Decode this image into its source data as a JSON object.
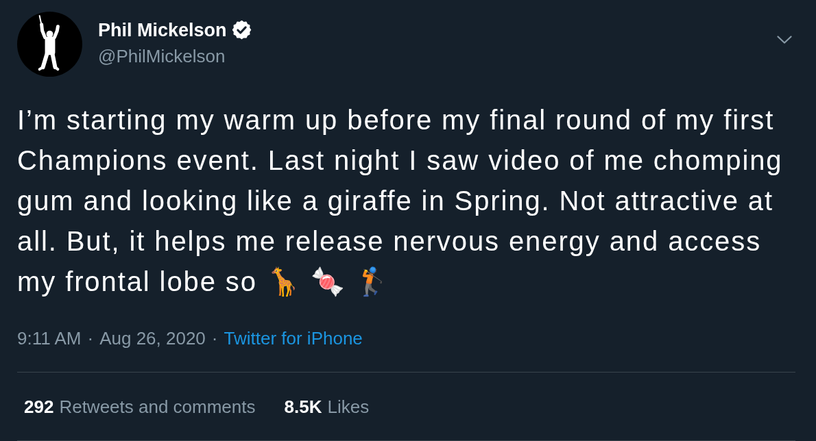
{
  "author": {
    "name": "Phil Mickelson",
    "verified": true,
    "handle": "@PhilMickelson"
  },
  "tweet": {
    "text": "I’m starting my warm up before my final round of my first Champions event. Last night I saw video of me chomping gum and looking like a giraffe in Spring. Not attractive at all. But, it helps me release nervous energy and access my frontal lobe so 🦒 🍬 🏌️"
  },
  "meta": [
    {
      "kind": "text",
      "text": "9:11 AM"
    },
    {
      "kind": "separator",
      "text": "·"
    },
    {
      "kind": "text",
      "text": "Aug 26, 2020"
    },
    {
      "kind": "separator",
      "text": "·"
    },
    {
      "kind": "link",
      "text": "Twitter for iPhone"
    }
  ],
  "stats": [
    {
      "count": "292",
      "label": "Retweets and comments"
    },
    {
      "count": "8.5K",
      "label": "Likes"
    }
  ]
}
